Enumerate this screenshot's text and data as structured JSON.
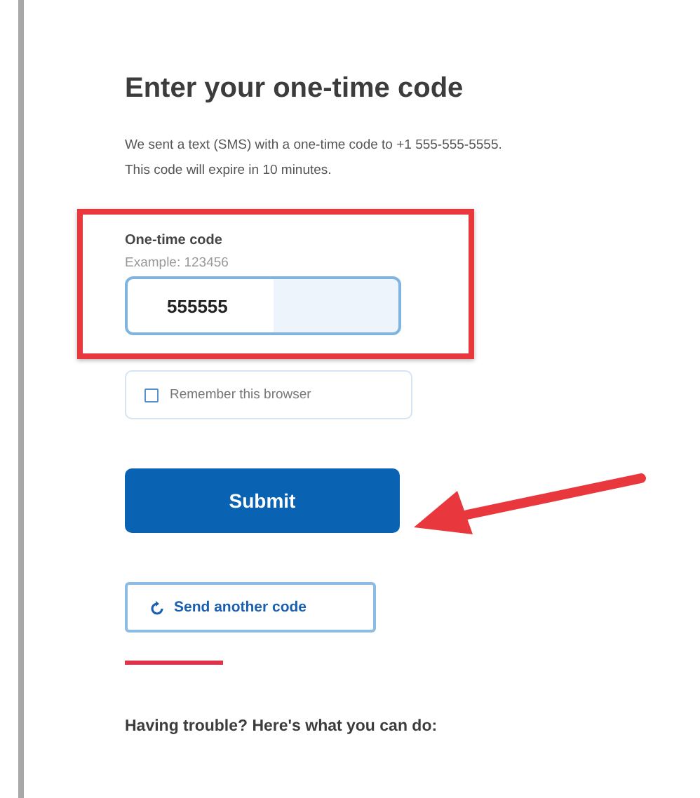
{
  "heading": "Enter your one-time code",
  "message": "We sent a text (SMS) with a one-time code to +1 555-555-5555. This code will expire in 10 minutes.",
  "code_field": {
    "label": "One-time code",
    "hint": "Example: 123456",
    "value": "555555"
  },
  "remember": {
    "label": "Remember this browser",
    "checked": false
  },
  "submit": {
    "label": "Submit"
  },
  "resend": {
    "label": "Send another code"
  },
  "trouble_heading": "Having trouble? Here's what you can do:"
}
